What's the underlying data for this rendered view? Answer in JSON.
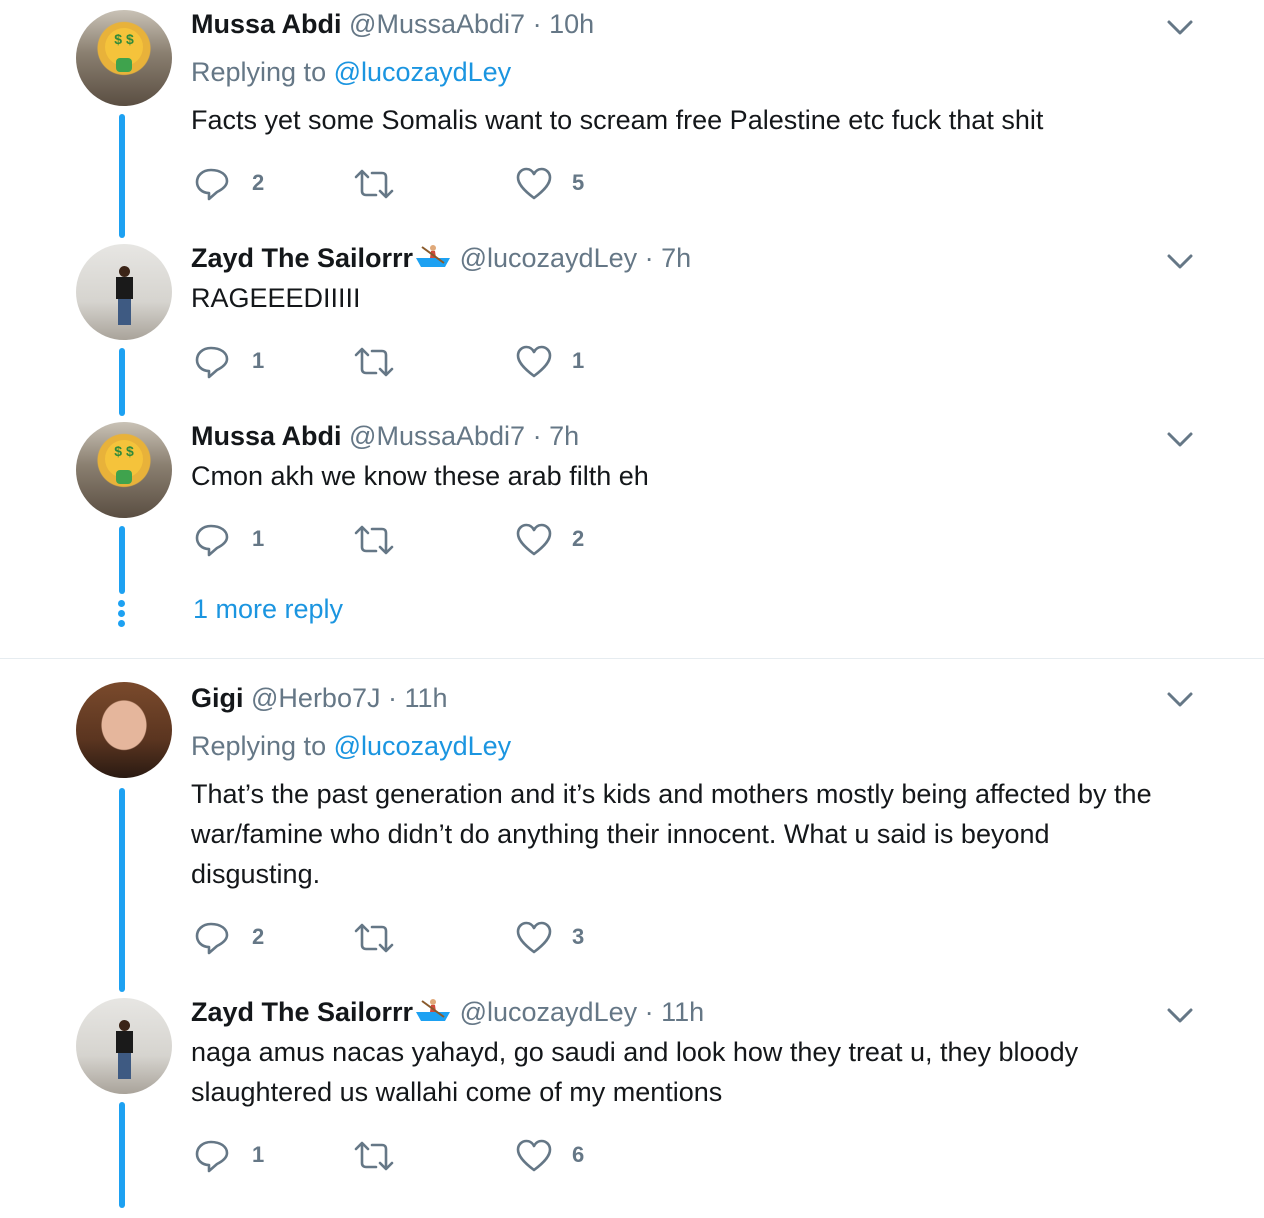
{
  "threads": [
    {
      "tweets": [
        {
          "name": "Mussa Abdi",
          "handle": "@MussaAbdi7",
          "time": "10h",
          "replying_label": "Replying to",
          "replying_to": "@lucozaydLey",
          "text": "Facts yet some Somalis want to scream free Palestine etc fuck that shit",
          "replies": "2",
          "retweets": "",
          "likes": "5"
        },
        {
          "name": "Zayd The Sailorrr",
          "name_emoji": "rowboat-emoji",
          "handle": "@lucozaydLey",
          "time": "7h",
          "text": "RAGEEEDIIIII",
          "replies": "1",
          "retweets": "",
          "likes": "1"
        },
        {
          "name": "Mussa Abdi",
          "handle": "@MussaAbdi7",
          "time": "7h",
          "text": "Cmon akh we know these arab filth eh",
          "replies": "1",
          "retweets": "",
          "likes": "2"
        }
      ],
      "more_reply": "1 more reply"
    },
    {
      "tweets": [
        {
          "name": "Gigi",
          "handle": "@Herbo7J",
          "time": "11h",
          "replying_label": "Replying to",
          "replying_to": "@lucozaydLey",
          "text": "That’s the past generation and it’s kids and mothers mostly being affected by the war/famine who didn’t do anything their innocent. What u said is beyond disgusting.",
          "replies": "2",
          "retweets": "",
          "likes": "3"
        },
        {
          "name": "Zayd The Sailorrr",
          "name_emoji": "rowboat-emoji",
          "handle": "@lucozaydLey",
          "time": "11h",
          "text": "naga amus nacas yahayd, go saudi and look how they treat u, they bloody slaughtered us wallahi come of my mentions",
          "replies": "1",
          "retweets": "",
          "likes": "6"
        }
      ]
    }
  ],
  "separator": "·",
  "colors": {
    "link": "#1b95e0",
    "thread_line": "#1da1f2",
    "muted": "#657786",
    "text": "#14171a"
  }
}
